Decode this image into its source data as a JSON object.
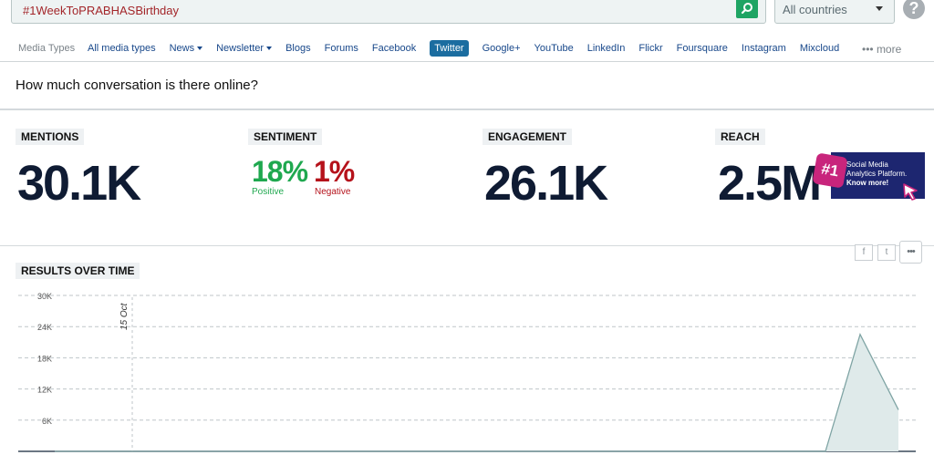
{
  "search": {
    "query": "#1WeekToPRABHASBirthday"
  },
  "country_select": {
    "value": "All countries"
  },
  "media_nav": {
    "label": "Media Types",
    "items": [
      {
        "label": "All media types",
        "dropdown": false,
        "active": false
      },
      {
        "label": "News",
        "dropdown": true,
        "active": false
      },
      {
        "label": "Newsletter",
        "dropdown": true,
        "active": false
      },
      {
        "label": "Blogs",
        "dropdown": false,
        "active": false
      },
      {
        "label": "Forums",
        "dropdown": false,
        "active": false
      },
      {
        "label": "Facebook",
        "dropdown": false,
        "active": false
      },
      {
        "label": "Twitter",
        "dropdown": false,
        "active": true
      },
      {
        "label": "Google+",
        "dropdown": false,
        "active": false
      },
      {
        "label": "YouTube",
        "dropdown": false,
        "active": false
      },
      {
        "label": "LinkedIn",
        "dropdown": false,
        "active": false
      },
      {
        "label": "Flickr",
        "dropdown": false,
        "active": false
      },
      {
        "label": "Foursquare",
        "dropdown": false,
        "active": false
      },
      {
        "label": "Instagram",
        "dropdown": false,
        "active": false
      },
      {
        "label": "Mixcloud",
        "dropdown": false,
        "active": false
      }
    ],
    "more": "••• more"
  },
  "question": "How much conversation is there online?",
  "metrics": {
    "mentions": {
      "label": "MENTIONS",
      "value": "30.1K"
    },
    "sentiment": {
      "label": "SENTIMENT",
      "positive": "18%",
      "positive_label": "Positive",
      "negative": "1%",
      "negative_label": "Negative"
    },
    "engagement": {
      "label": "ENGAGEMENT",
      "value": "26.1K"
    },
    "reach": {
      "label": "REACH",
      "value": "2.5M"
    }
  },
  "ad": {
    "badge": "#1",
    "line1": "Social Media",
    "line2": "Analytics Platform.",
    "cta": "Know more!"
  },
  "share": {
    "facebook": "f",
    "twitter": "t",
    "more": "•••"
  },
  "results": {
    "label": "RESULTS OVER TIME"
  },
  "chart_data": {
    "type": "area",
    "title": "",
    "xlabel": "",
    "ylabel": "",
    "ylim": [
      0,
      30000
    ],
    "yticks": [
      {
        "value": 30000,
        "label": "30K"
      },
      {
        "value": 24000,
        "label": "24K"
      },
      {
        "value": 18000,
        "label": "18K"
      },
      {
        "value": 12000,
        "label": "12K"
      },
      {
        "value": 6000,
        "label": "6K"
      }
    ],
    "grid": true,
    "x_annotation": "15 Oct",
    "x": [
      "d1",
      "d2",
      "d3",
      "d4",
      "d5"
    ],
    "values": [
      0,
      0,
      0,
      22500,
      8000
    ],
    "color": "#7fa4a4",
    "fill": "#dfeaea"
  }
}
